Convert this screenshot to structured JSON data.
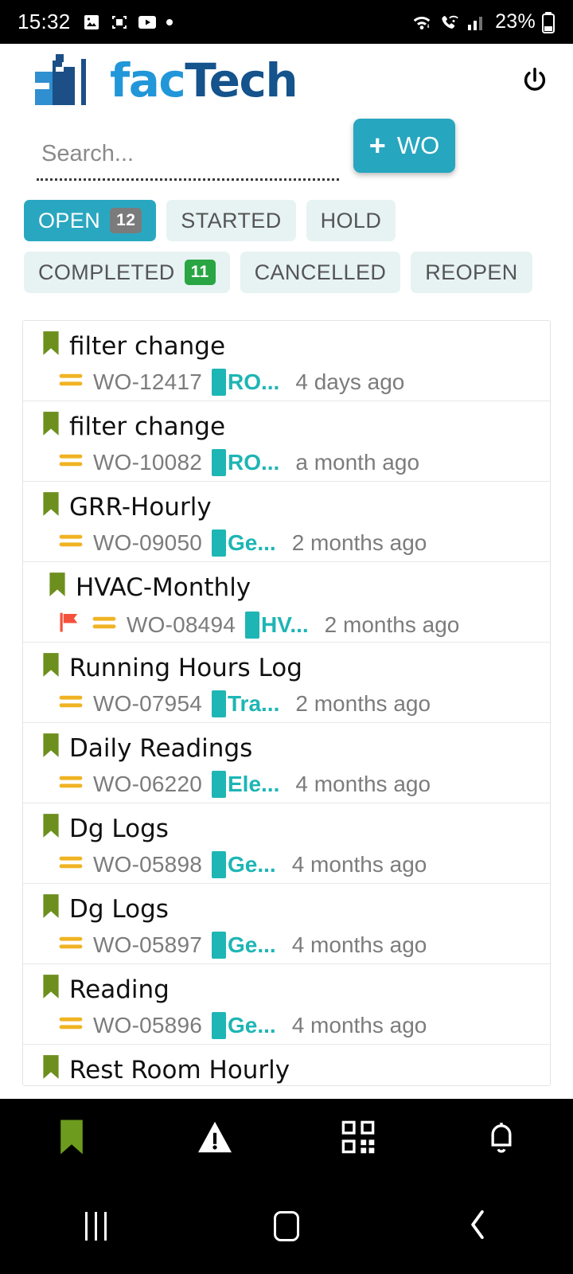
{
  "status_bar": {
    "time": "15:32",
    "battery_percent": "23%",
    "left_icons": [
      "gallery-icon",
      "screenshot-icon",
      "youtube-icon",
      "dot-icon"
    ],
    "right_icons": [
      "wifi-icon",
      "wifi-call-icon",
      "signal-icon",
      "battery-icon"
    ]
  },
  "header": {
    "logo_primary": "fac",
    "logo_secondary": "Tech",
    "logo_mark": "factory-building-icon",
    "power_icon": "power-icon"
  },
  "search": {
    "placeholder": "Search...",
    "value": ""
  },
  "actions": {
    "new_wo_plus": "+",
    "new_wo_label": "WO"
  },
  "tabs": [
    {
      "label": "OPEN",
      "badge": "12",
      "badge_color": "#7b7b7b",
      "active": true
    },
    {
      "label": "STARTED",
      "badge": "",
      "badge_color": "",
      "active": false
    },
    {
      "label": "HOLD",
      "badge": "",
      "badge_color": "",
      "active": false
    },
    {
      "label": "COMPLETED",
      "badge": "11",
      "badge_color": "#2aa544",
      "active": false
    },
    {
      "label": "CANCELLED",
      "badge": "",
      "badge_color": "",
      "active": false
    },
    {
      "label": "REOPEN",
      "badge": "",
      "badge_color": "",
      "active": false
    }
  ],
  "work_orders": [
    {
      "title": "filter change",
      "wo": "WO-12417",
      "tag": "RO...",
      "time": "4 days ago",
      "flagged": false
    },
    {
      "title": "filter change",
      "wo": "WO-10082",
      "tag": "RO...",
      "time": "a month ago",
      "flagged": false
    },
    {
      "title": "GRR-Hourly",
      "wo": "WO-09050",
      "tag": "Ge...",
      "time": "2 months ago",
      "flagged": false
    },
    {
      "title": "HVAC-Monthly",
      "wo": "WO-08494",
      "tag": "HV...",
      "time": "2 months ago",
      "flagged": true
    },
    {
      "title": "Running Hours Log",
      "wo": "WO-07954",
      "tag": "Tra...",
      "time": "2 months ago",
      "flagged": false
    },
    {
      "title": "Daily Readings",
      "wo": "WO-06220",
      "tag": "Ele...",
      "time": "4 months ago",
      "flagged": false
    },
    {
      "title": "Dg Logs",
      "wo": "WO-05898",
      "tag": "Ge...",
      "time": "4 months ago",
      "flagged": false
    },
    {
      "title": "Dg Logs",
      "wo": "WO-05897",
      "tag": "Ge...",
      "time": "4 months ago",
      "flagged": false
    },
    {
      "title": "Reading",
      "wo": "WO-05896",
      "tag": "Ge...",
      "time": "4 months ago",
      "flagged": false
    },
    {
      "title": "Rest Room Hourly",
      "wo": "",
      "tag": "",
      "time": "",
      "flagged": false
    }
  ],
  "bottom_nav": [
    {
      "icon": "bookmark-icon",
      "active": true
    },
    {
      "icon": "warning-triangle-icon",
      "active": false
    },
    {
      "icon": "qr-code-icon",
      "active": false
    },
    {
      "icon": "bell-icon",
      "active": false
    }
  ],
  "android_nav": [
    {
      "icon": "recents-icon"
    },
    {
      "icon": "home-icon"
    },
    {
      "icon": "back-icon"
    }
  ],
  "colors": {
    "accent_teal": "#27a6bf",
    "tab_active": "#2aa7c0",
    "tab_inactive_bg": "#e6f3f2",
    "badge_green": "#2aa544",
    "bookmark_green": "#6d8f1e",
    "flag_red": "#f4513c",
    "tag_teal": "#1eb5b5",
    "priority_orange": "#f0b323",
    "logo_light_blue": "#2196d8",
    "logo_dark_blue": "#14538c"
  }
}
